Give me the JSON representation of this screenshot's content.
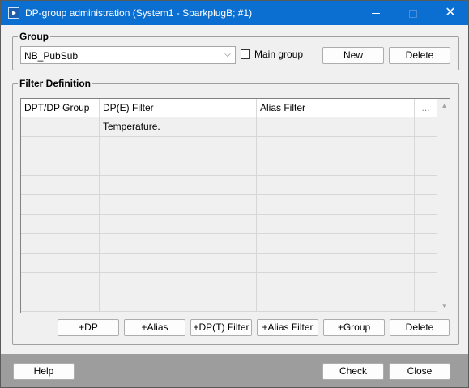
{
  "window": {
    "title": "DP-group administration (System1 - SparkplugB; #1)",
    "controls": {
      "minimize": "—",
      "maximize": "□",
      "close": "✕"
    }
  },
  "group_section": {
    "legend": "Group",
    "group_select": {
      "value": "NB_PubSub",
      "arrow": "⌵"
    },
    "main_group_checkbox": {
      "label": "Main group",
      "checked": false
    },
    "new_label": "New",
    "delete_label": "Delete"
  },
  "filter_section": {
    "legend": "Filter Definition",
    "table": {
      "columns": [
        "DPT/DP Group",
        "DP(E) Filter",
        "Alias Filter",
        "..."
      ],
      "rows": [
        [
          "",
          "Temperature.",
          "",
          ""
        ],
        [
          "",
          "",
          "",
          ""
        ],
        [
          "",
          "",
          "",
          ""
        ],
        [
          "",
          "",
          "",
          ""
        ],
        [
          "",
          "",
          "",
          ""
        ],
        [
          "",
          "",
          "",
          ""
        ],
        [
          "",
          "",
          "",
          ""
        ],
        [
          "",
          "",
          "",
          ""
        ],
        [
          "",
          "",
          "",
          ""
        ],
        [
          "",
          "",
          "",
          ""
        ]
      ],
      "scroll_up": "▲",
      "scroll_down": "▼"
    },
    "buttons": {
      "add_dp": "+DP",
      "add_alias": "+Alias",
      "add_dpt_filter": "+DP(T) Filter",
      "add_alias_filter": "+Alias Filter",
      "add_group": "+Group",
      "delete": "Delete"
    }
  },
  "footer": {
    "help_label": "Help",
    "check_label": "Check",
    "close_label": "Close"
  },
  "colors": {
    "titlebar": "#0b6fd1",
    "dialog_background": "#f0f0f0",
    "footer": "#9d9d9d"
  }
}
